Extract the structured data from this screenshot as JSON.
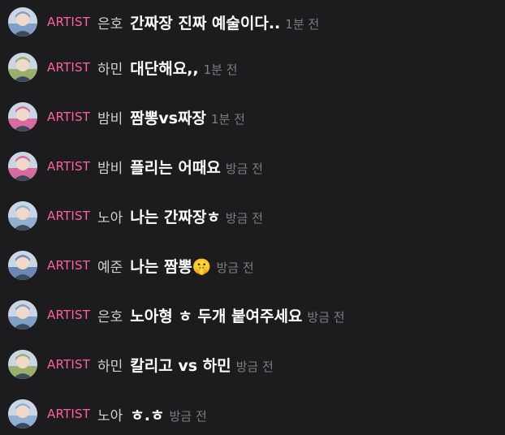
{
  "badge_color": "#ff5fa3",
  "background_color": "#1c1c1e",
  "messages": [
    {
      "badge": "ARTIST",
      "name": "은호",
      "text": "간짜장 진짜 예술이다..",
      "time": "1분 전",
      "avatar_hue": "#7fa0c4"
    },
    {
      "badge": "ARTIST",
      "name": "하민",
      "text": "대단해요,,",
      "time": "1분 전",
      "avatar_hue": "#9ab06a"
    },
    {
      "badge": "ARTIST",
      "name": "밤비",
      "text": "짬뽕vs짜장",
      "time": "1분 전",
      "avatar_hue": "#d96aa0"
    },
    {
      "badge": "ARTIST",
      "name": "밤비",
      "text": "플리는 어때요",
      "time": "방금 전",
      "avatar_hue": "#d96aa0"
    },
    {
      "badge": "ARTIST",
      "name": "노아",
      "text": "나는 간짜장ㅎ",
      "time": "방금 전",
      "avatar_hue": "#8fb0d0"
    },
    {
      "badge": "ARTIST",
      "name": "예준",
      "text": "나는 짬뽕🤫",
      "time": "방금 전",
      "avatar_hue": "#6d86b8"
    },
    {
      "badge": "ARTIST",
      "name": "은호",
      "text": "노아형 ㅎ 두개 붙여주세요",
      "time": "방금 전",
      "avatar_hue": "#7fa0c4"
    },
    {
      "badge": "ARTIST",
      "name": "하민",
      "text": "칼리고 vs 하민",
      "time": "방금 전",
      "avatar_hue": "#9ab06a"
    },
    {
      "badge": "ARTIST",
      "name": "노아",
      "text": "ㅎ.ㅎ",
      "time": "방금 전",
      "avatar_hue": "#8fb0d0"
    }
  ]
}
